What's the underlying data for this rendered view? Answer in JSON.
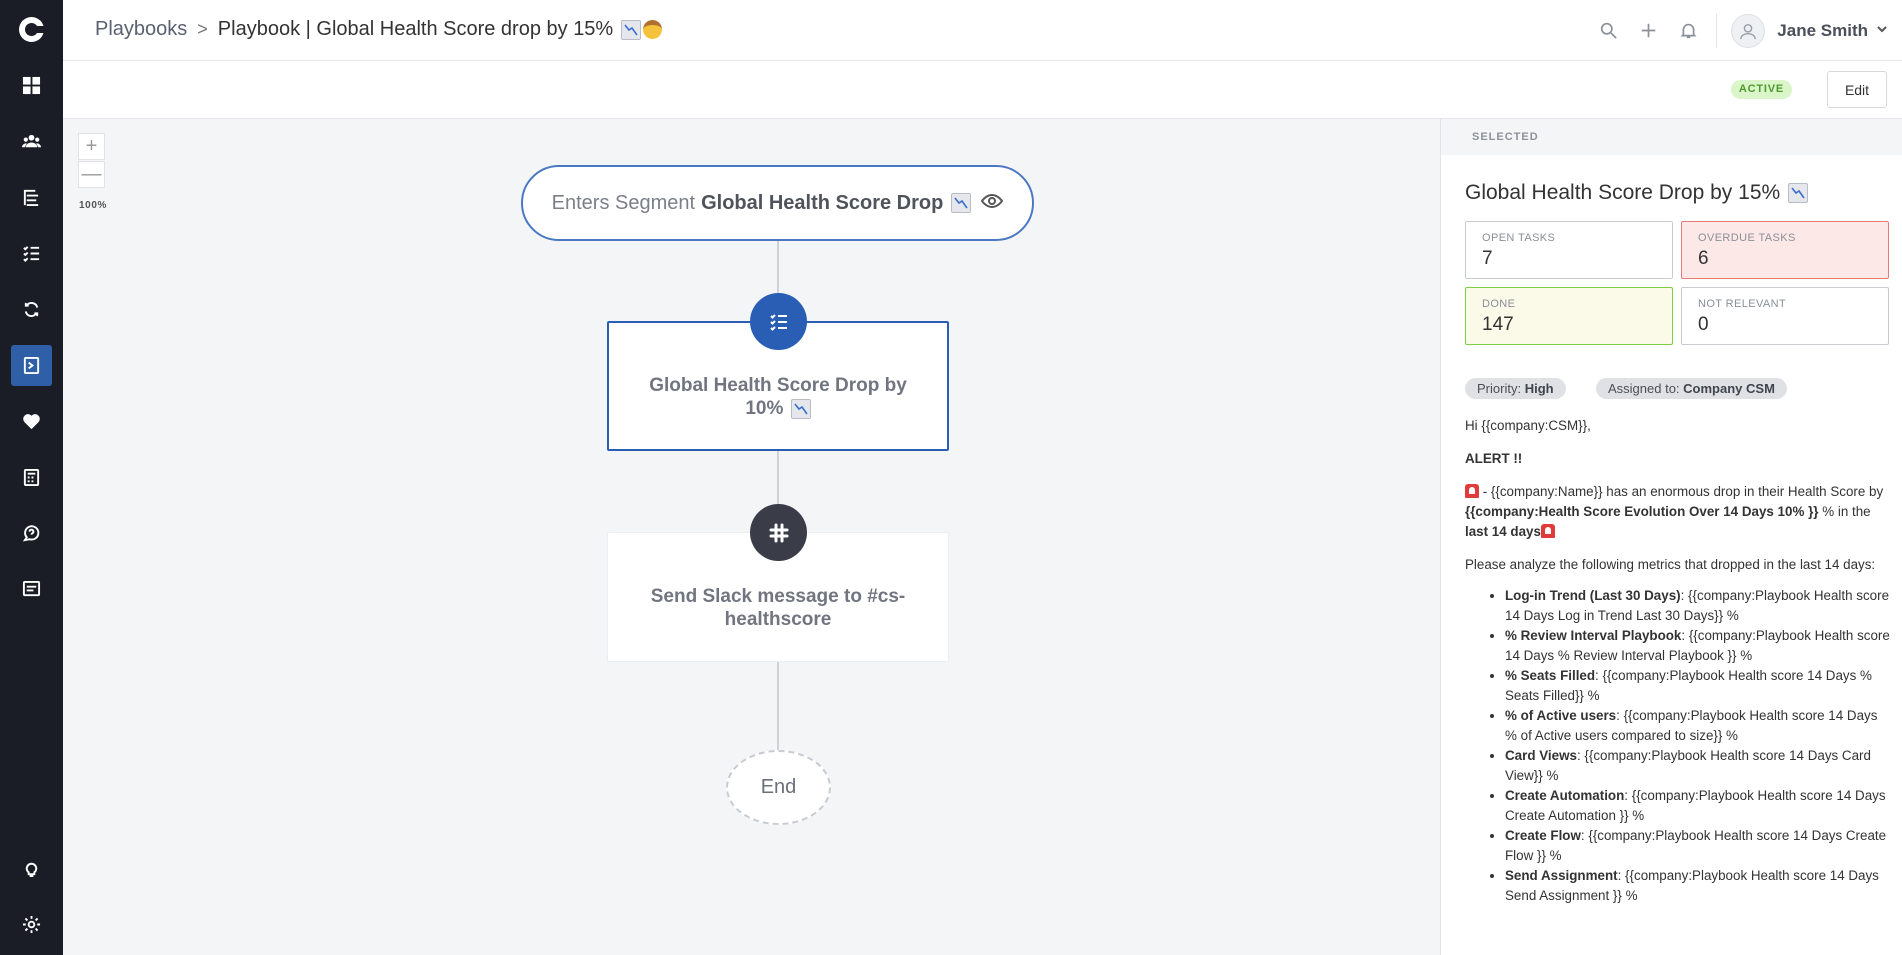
{
  "header": {
    "breadcrumb_parent": "Playbooks",
    "breadcrumb_separator": ">",
    "breadcrumb_current": "Playbook | Global Health Score drop by 15%",
    "user_name": "Jane Smith"
  },
  "toolbar": {
    "status": "ACTIVE",
    "edit_label": "Edit"
  },
  "canvas": {
    "zoom_in": "+",
    "zoom_out": "—",
    "zoom_level": "100%",
    "trigger_prefix": "Enters Segment",
    "trigger_segment": "Global Health Score Drop",
    "task_title": "Global Health Score Drop by 10%",
    "slack_title": "Send Slack message to #cs-healthscore",
    "end_label": "End"
  },
  "panel": {
    "header": "SELECTED",
    "title": "Global Health Score Drop by 15%",
    "stats": {
      "open_label": "OPEN TASKS",
      "open_value": "7",
      "overdue_label": "OVERDUE TASKS",
      "overdue_value": "6",
      "done_label": "DONE",
      "done_value": "147",
      "not_relevant_label": "NOT RELEVANT",
      "not_relevant_value": "0"
    },
    "priority_label": "Priority:",
    "priority_value": "High",
    "assigned_label": "Assigned to:",
    "assigned_value": "Company CSM",
    "message": {
      "greeting": "Hi {{company:CSM}},",
      "alert": "ALERT !!",
      "line_a": " - {{company:Name}} has an enormous drop in their Health Score by ",
      "line_b_bold": "{{company:Health Score Evolution Over 14 Days 10% }}",
      "line_c": " % in the ",
      "line_d_bold": "last 14 days",
      "analyze": "Please analyze the following metrics that dropped in the last 14 days:",
      "metrics": [
        {
          "name": "Log-in Trend (Last 30 Days)",
          "value": ": {{company:Playbook Health score 14 Days Log in Trend Last 30 Days}} %"
        },
        {
          "name": "% Review Interval Playbook",
          "value": ": {{company:Playbook Health score 14 Days % Review Interval Playbook }} %"
        },
        {
          "name": "% Seats Filled",
          "value": ": {{company:Playbook Health score  14 Days  % Seats Filled}} %"
        },
        {
          "name": "% of Active users",
          "value": ": {{company:Playbook Health score 14 Days % of Active users compared to size}} %"
        },
        {
          "name": "Card Views",
          "value": ": {{company:Playbook Health score  14 Days Card View}} %"
        },
        {
          "name": "Create Automation",
          "value": ": {{company:Playbook Health score 14 Days Create Automation }} %"
        },
        {
          "name": "Create Flow",
          "value": ": {{company:Playbook Health score 14 Days Create Flow }} %"
        },
        {
          "name": "Send Assignment",
          "value": ": {{company:Playbook Health score 14 Days Send Assignment }} %"
        }
      ]
    }
  },
  "icons": {
    "sidebar": [
      "dashboard-icon",
      "users-icon",
      "hierarchy-icon",
      "checklist-icon",
      "sync-icon",
      "playbook-icon",
      "heart-pulse-icon",
      "calculator-icon",
      "help-icon",
      "chat-icon",
      "lightbulb-icon",
      "gear-icon"
    ],
    "header": [
      "search-icon",
      "plus-icon",
      "bell-icon",
      "avatar-icon",
      "chevron-down-icon"
    ]
  },
  "colors": {
    "sidebar": "#1a1d26",
    "accent": "#2a5eb5",
    "active_badge": "#d9f5c9",
    "overdue": "#fde8e8",
    "done": "#fbfae8"
  }
}
